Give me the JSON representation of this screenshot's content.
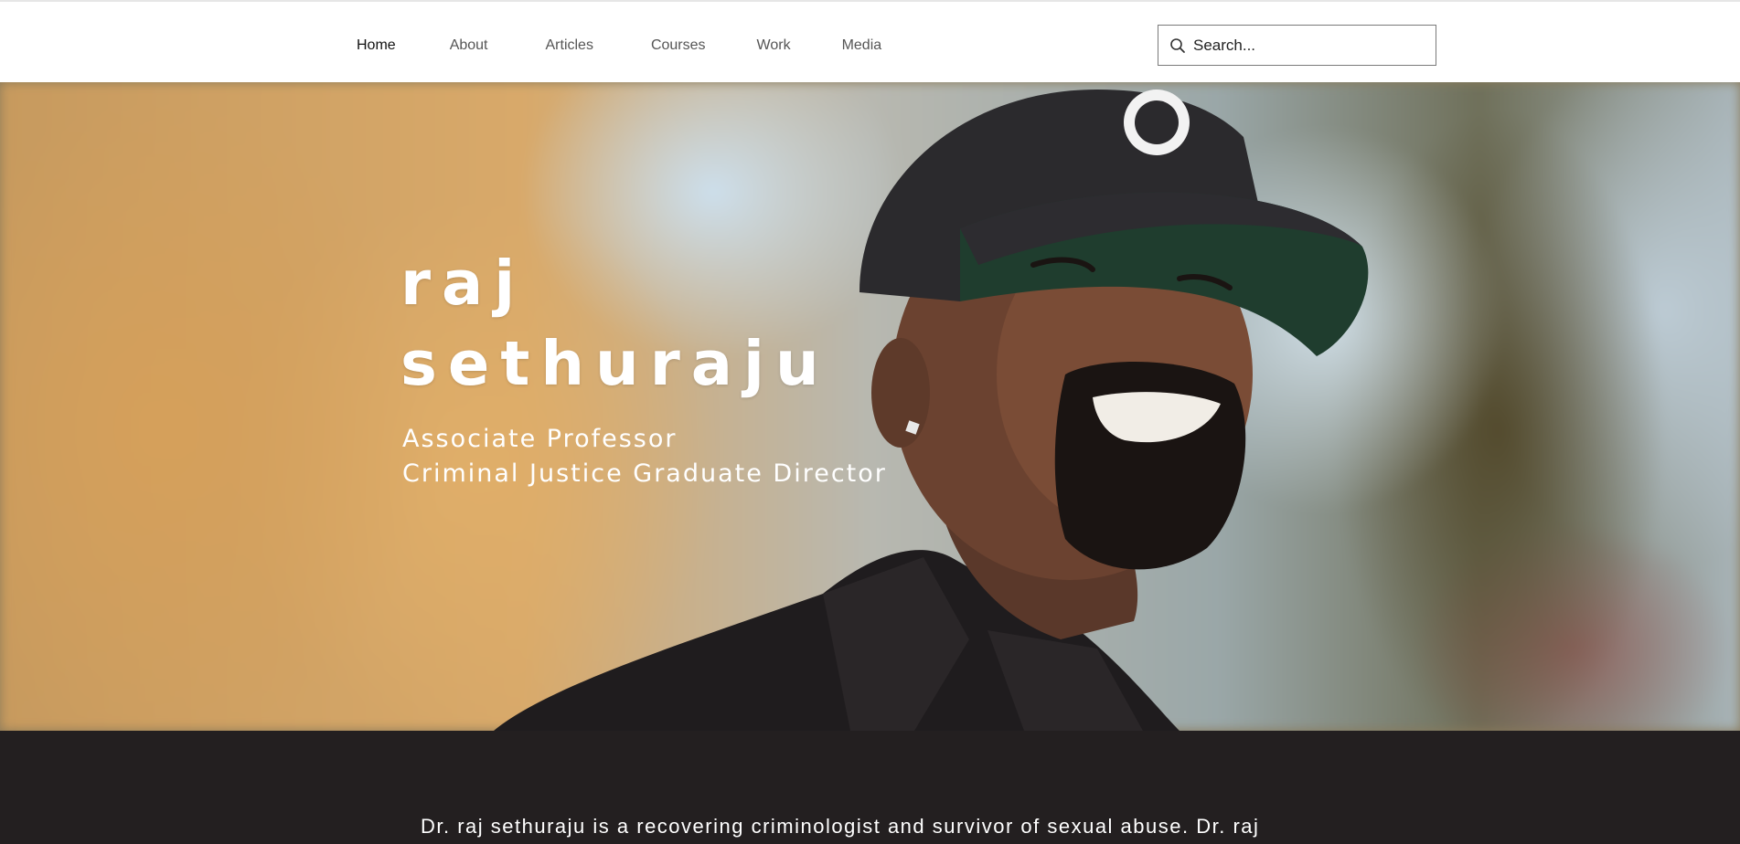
{
  "nav": {
    "items": [
      {
        "label": "Home",
        "active": true
      },
      {
        "label": "About"
      },
      {
        "label": "Articles"
      },
      {
        "label": "Courses"
      },
      {
        "label": "Work"
      },
      {
        "label": "Media"
      }
    ]
  },
  "search": {
    "placeholder": "Search...",
    "icon": "search-icon"
  },
  "hero": {
    "name_line1": "raj",
    "name_line2": "sethuraju",
    "subtitle_line1": "Associate Professor",
    "subtitle_line2": "Criminal Justice Graduate Director"
  },
  "bio": {
    "text": "Dr. raj sethuraju is a recovering criminologist and survivor of sexual abuse. Dr. raj"
  },
  "colors": {
    "header_bg": "#ffffff",
    "bio_bg": "#231f20",
    "hero_text": "#ffffff",
    "nav_text": "#555555"
  }
}
